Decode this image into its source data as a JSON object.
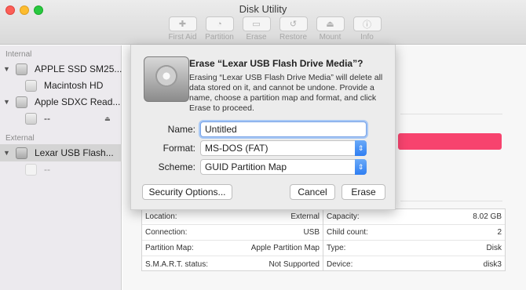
{
  "window": {
    "title": "Disk Utility"
  },
  "toolbar": {
    "items": [
      {
        "label": "First Aid",
        "icon": "first-aid-icon"
      },
      {
        "label": "Partition",
        "icon": "partition-icon"
      },
      {
        "label": "Erase",
        "icon": "erase-icon"
      },
      {
        "label": "Restore",
        "icon": "restore-icon"
      },
      {
        "label": "Mount",
        "icon": "mount-icon"
      },
      {
        "label": "Info",
        "icon": "info-icon"
      }
    ]
  },
  "sidebar": {
    "internal_header": "Internal",
    "external_header": "External",
    "items": [
      {
        "label": "APPLE SSD SM25..."
      },
      {
        "label": "Macintosh HD"
      },
      {
        "label": "Apple SDXC Read..."
      },
      {
        "label": "--"
      },
      {
        "label": "Lexar USB Flash..."
      },
      {
        "label": "--"
      }
    ]
  },
  "sheet": {
    "title": "Erase “Lexar USB Flash Drive Media”?",
    "message": "Erasing “Lexar USB Flash Drive Media” will delete all data stored on it, and cannot be undone. Provide a name, choose a partition map and format, and click Erase to proceed.",
    "name_label": "Name:",
    "name_value": "Untitled",
    "format_label": "Format:",
    "format_value": "MS-DOS (FAT)",
    "scheme_label": "Scheme:",
    "scheme_value": "GUID Partition Map",
    "security_button": "Security Options...",
    "cancel_button": "Cancel",
    "erase_button": "Erase"
  },
  "info": {
    "left": [
      {
        "key": "Location:",
        "value": "External"
      },
      {
        "key": "Connection:",
        "value": "USB"
      },
      {
        "key": "Partition Map:",
        "value": "Apple Partition Map"
      },
      {
        "key": "S.M.A.R.T. status:",
        "value": "Not Supported"
      }
    ],
    "right": [
      {
        "key": "Capacity:",
        "value": "8.02 GB"
      },
      {
        "key": "Child count:",
        "value": "2"
      },
      {
        "key": "Type:",
        "value": "Disk"
      },
      {
        "key": "Device:",
        "value": "disk3"
      }
    ]
  },
  "colors": {
    "accent": "#2f7ef2",
    "usage_bar": "#f7436e",
    "selection": "#d4d4d4"
  }
}
